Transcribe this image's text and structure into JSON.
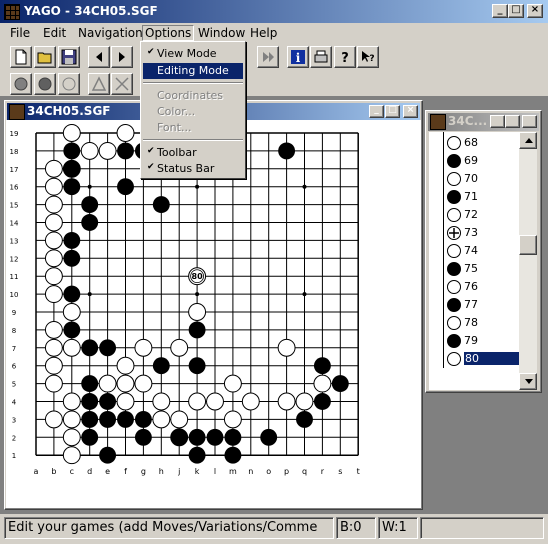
{
  "window": {
    "title": "YAGO - 34CH05.SGF"
  },
  "menu": [
    "File",
    "Edit",
    "Navigation",
    "Options",
    "Window",
    "Help"
  ],
  "options_menu": {
    "items": [
      {
        "label": "View Mode",
        "checked": true,
        "state": "normal"
      },
      {
        "label": "Editing Mode",
        "checked": false,
        "state": "highlighted"
      },
      {
        "label": "Coordinates",
        "checked": false,
        "state": "disabled"
      },
      {
        "label": "Color...",
        "checked": false,
        "state": "disabled"
      },
      {
        "label": "Font...",
        "checked": false,
        "state": "disabled"
      },
      {
        "label": "Toolbar",
        "checked": true,
        "state": "normal"
      },
      {
        "label": "Status Bar",
        "checked": true,
        "state": "normal"
      }
    ]
  },
  "board_window": {
    "title": "34CH05.SGF"
  },
  "tree_window": {
    "title": "34C..."
  },
  "board": {
    "size": 19,
    "col_labels": [
      "a",
      "b",
      "c",
      "d",
      "e",
      "f",
      "g",
      "h",
      "j",
      "k",
      "l",
      "m",
      "n",
      "o",
      "p",
      "q",
      "r",
      "s",
      "t"
    ],
    "row_labels": [
      "19",
      "18",
      "17",
      "16",
      "15",
      "14",
      "13",
      "12",
      "11",
      "10",
      "9",
      "8",
      "7",
      "6",
      "5",
      "4",
      "3",
      "2",
      "1"
    ],
    "last_move_label": "80",
    "black": [
      [
        3,
        2
      ],
      [
        6,
        2
      ],
      [
        7,
        2
      ],
      [
        11,
        2
      ],
      [
        15,
        2
      ],
      [
        3,
        3
      ],
      [
        3,
        4
      ],
      [
        6,
        4
      ],
      [
        4,
        5
      ],
      [
        8,
        5
      ],
      [
        4,
        6
      ],
      [
        3,
        7
      ],
      [
        3,
        8
      ],
      [
        10,
        9
      ],
      [
        3,
        10
      ],
      [
        10,
        12
      ],
      [
        3,
        12
      ],
      [
        4,
        13
      ],
      [
        5,
        13
      ],
      [
        8,
        14
      ],
      [
        10,
        14
      ],
      [
        4,
        15
      ],
      [
        18,
        15
      ],
      [
        17,
        14
      ],
      [
        4,
        16
      ],
      [
        5,
        16
      ],
      [
        6,
        17
      ],
      [
        4,
        17
      ],
      [
        5,
        17
      ],
      [
        7,
        17
      ],
      [
        7,
        18
      ],
      [
        4,
        18
      ],
      [
        9,
        18
      ],
      [
        10,
        18
      ],
      [
        11,
        18
      ],
      [
        12,
        18
      ],
      [
        14,
        18
      ],
      [
        5,
        19
      ],
      [
        10,
        19
      ],
      [
        12,
        19
      ],
      [
        16,
        17
      ],
      [
        17,
        16
      ]
    ],
    "white": [
      [
        3,
        1
      ],
      [
        6,
        1
      ],
      [
        9,
        1
      ],
      [
        4,
        2
      ],
      [
        5,
        2
      ],
      [
        2,
        3
      ],
      [
        3,
        3
      ],
      [
        2,
        4
      ],
      [
        2,
        5
      ],
      [
        2,
        6
      ],
      [
        2,
        7
      ],
      [
        2,
        8
      ],
      [
        2,
        9
      ],
      [
        2,
        10
      ],
      [
        3,
        11
      ],
      [
        3,
        13
      ],
      [
        2,
        13
      ],
      [
        2,
        12
      ],
      [
        2,
        14
      ],
      [
        2,
        15
      ],
      [
        5,
        15
      ],
      [
        6,
        15
      ],
      [
        7,
        15
      ],
      [
        8,
        16
      ],
      [
        9,
        17
      ],
      [
        10,
        16
      ],
      [
        11,
        16
      ],
      [
        12,
        17
      ],
      [
        13,
        16
      ],
      [
        6,
        16
      ],
      [
        3,
        16
      ],
      [
        2,
        17
      ],
      [
        3,
        17
      ],
      [
        6,
        14
      ],
      [
        9,
        13
      ],
      [
        12,
        15
      ],
      [
        15,
        16
      ],
      [
        16,
        16
      ],
      [
        17,
        15
      ],
      [
        3,
        18
      ],
      [
        9,
        18
      ],
      [
        10,
        11
      ],
      [
        15,
        13
      ],
      [
        3,
        19
      ],
      [
        7,
        13
      ],
      [
        8,
        17
      ]
    ],
    "hoshi": [
      [
        4,
        4
      ],
      [
        4,
        10
      ],
      [
        4,
        16
      ],
      [
        10,
        4
      ],
      [
        10,
        10
      ],
      [
        10,
        16
      ],
      [
        16,
        4
      ],
      [
        16,
        10
      ],
      [
        16,
        16
      ]
    ]
  },
  "tree": {
    "rows": [
      {
        "label": "68",
        "color": "white"
      },
      {
        "label": "69",
        "color": "black"
      },
      {
        "label": "70",
        "color": "white"
      },
      {
        "label": "71",
        "color": "black"
      },
      {
        "label": "72",
        "color": "white"
      },
      {
        "label": "73",
        "color": "white"
      },
      {
        "label": "74",
        "color": "white"
      },
      {
        "label": "75",
        "color": "black"
      },
      {
        "label": "76",
        "color": "white"
      },
      {
        "label": "77",
        "color": "black"
      },
      {
        "label": "78",
        "color": "white"
      },
      {
        "label": "79",
        "color": "black"
      },
      {
        "label": "80",
        "color": "white"
      }
    ],
    "selected_index": 12
  },
  "status": {
    "message": "Edit your games (add Moves/Variations/Comme",
    "black": "B:0",
    "white": "W:1"
  }
}
